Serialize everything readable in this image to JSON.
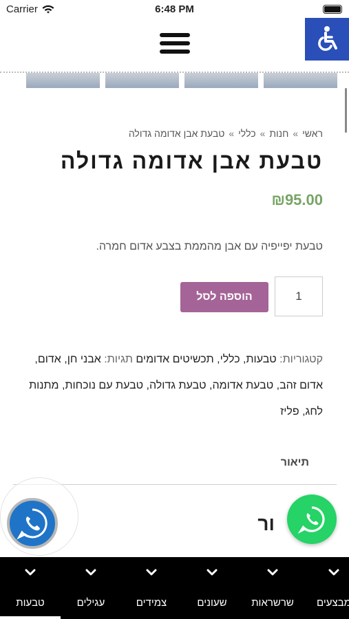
{
  "status_bar": {
    "carrier": "Carrier",
    "time": "6:48 PM"
  },
  "breadcrumb": [
    {
      "label": "ראשי"
    },
    {
      "label": "חנות"
    },
    {
      "label": "כללי"
    },
    {
      "label": "טבעת אבן אדומה גדולה"
    }
  ],
  "breadcrumb_separator": "»",
  "product": {
    "title": "טבעת אבן אדומה גדולה",
    "price": "₪95.00",
    "short_description": "טבעת יפייפיה עם אבן מהממת בצבע אדום חמרה.",
    "quantity": "1",
    "add_to_cart_label": "הוספה לסל"
  },
  "meta": {
    "categories_label": "קטגוריות:",
    "categories": [
      "טבעות",
      "כללי",
      "תכשיטים אדומים"
    ],
    "tags_label": "תגיות:",
    "tags": [
      "אבני חן",
      "אדום",
      "אדום זהב",
      "טבעת אדומה",
      "טבעת גדולה",
      "טבעת עם נוכחות",
      "מתנות לחג",
      "פליז"
    ]
  },
  "tabs": {
    "description_tab": "תיאור",
    "description_heading_partial": "ור"
  },
  "bottom_nav": [
    {
      "label": "טבעות",
      "active": true
    },
    {
      "label": "עגילים"
    },
    {
      "label": "צמידים"
    },
    {
      "label": "שעונים"
    },
    {
      "label": "שרשראות"
    },
    {
      "label": "מבצעים"
    }
  ],
  "colors": {
    "price": "#77a464",
    "add_to_cart": "#a46497",
    "accessibility_button": "#2a4fb8",
    "whatsapp": "#25d366",
    "call_button": "#1f74c8",
    "nav_background": "#000000"
  },
  "icons": {
    "menu": "hamburger-menu-icon",
    "accessibility": "wheelchair-icon",
    "call": "phone-icon",
    "whatsapp": "whatsapp-icon",
    "nav_dropdown": "chevron-down-icon"
  }
}
